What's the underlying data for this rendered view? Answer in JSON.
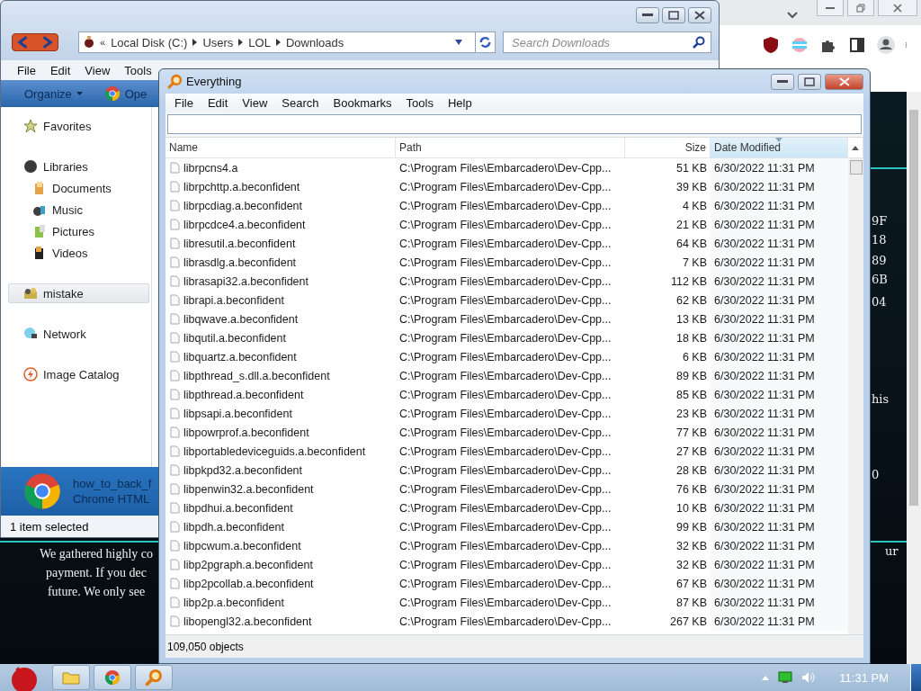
{
  "browser": {
    "page_lines": [
      "We gathered highly co",
      "payment. If you dec",
      "future. We only see"
    ],
    "page_fragments": [
      {
        "text": "ur",
        "kind": "right"
      },
      {
        "text": "9F",
        "kind": "edge"
      },
      {
        "text": "18",
        "kind": "edge"
      },
      {
        "text": "89",
        "kind": "edge"
      },
      {
        "text": "6B",
        "kind": "edge"
      },
      {
        "text": "04",
        "kind": "edge"
      },
      {
        "text": "his",
        "kind": "edge"
      },
      {
        "text": "0",
        "kind": "edge"
      }
    ]
  },
  "explorer": {
    "overflow": "«",
    "crumbs": [
      "Local Disk (C:)",
      "Users",
      "LOL",
      "Downloads"
    ],
    "search": {
      "placeholder": "Search Downloads"
    },
    "menu": [
      "File",
      "Edit",
      "View",
      "Tools"
    ],
    "commands": [
      "Organize",
      "Ope"
    ],
    "sidebar": [
      {
        "label": "Favorites",
        "kind": "star",
        "selected": false
      },
      {
        "label": "Libraries",
        "kind": "library",
        "selected": false,
        "children": [
          {
            "label": "Documents",
            "kind": "docs"
          },
          {
            "label": "Music",
            "kind": "music"
          },
          {
            "label": "Pictures",
            "kind": "pictures"
          },
          {
            "label": "Videos",
            "kind": "videos"
          }
        ]
      },
      {
        "label": "mistake",
        "kind": "homegroup",
        "selected": true
      },
      {
        "label": "Network",
        "kind": "network",
        "selected": false
      },
      {
        "label": "Image Catalog",
        "kind": "catalog",
        "selected": false
      }
    ],
    "details": {
      "name": "how_to_back_f",
      "type": "Chrome HTML"
    },
    "status": "1 item selected"
  },
  "everything": {
    "title": "Everything",
    "menu": [
      "File",
      "Edit",
      "View",
      "Search",
      "Bookmarks",
      "Tools",
      "Help"
    ],
    "columns": [
      {
        "label": "Name",
        "sorted": false
      },
      {
        "label": "Path",
        "sorted": false
      },
      {
        "label": "Size",
        "sorted": false
      },
      {
        "label": "Date Modified",
        "sorted": true
      }
    ],
    "rows": [
      {
        "name": "librpcns4.a",
        "path": "C:\\Program Files\\Embarcadero\\Dev-Cpp...",
        "size": "51 KB",
        "date": "6/30/2022 11:31 PM"
      },
      {
        "name": "librpchttp.a.beconfident",
        "path": "C:\\Program Files\\Embarcadero\\Dev-Cpp...",
        "size": "39 KB",
        "date": "6/30/2022 11:31 PM"
      },
      {
        "name": "librpcdiag.a.beconfident",
        "path": "C:\\Program Files\\Embarcadero\\Dev-Cpp...",
        "size": "4 KB",
        "date": "6/30/2022 11:31 PM"
      },
      {
        "name": "librpcdce4.a.beconfident",
        "path": "C:\\Program Files\\Embarcadero\\Dev-Cpp...",
        "size": "21 KB",
        "date": "6/30/2022 11:31 PM"
      },
      {
        "name": "libresutil.a.beconfident",
        "path": "C:\\Program Files\\Embarcadero\\Dev-Cpp...",
        "size": "64 KB",
        "date": "6/30/2022 11:31 PM"
      },
      {
        "name": "librasdlg.a.beconfident",
        "path": "C:\\Program Files\\Embarcadero\\Dev-Cpp...",
        "size": "7 KB",
        "date": "6/30/2022 11:31 PM"
      },
      {
        "name": "librasapi32.a.beconfident",
        "path": "C:\\Program Files\\Embarcadero\\Dev-Cpp...",
        "size": "112 KB",
        "date": "6/30/2022 11:31 PM"
      },
      {
        "name": "librapi.a.beconfident",
        "path": "C:\\Program Files\\Embarcadero\\Dev-Cpp...",
        "size": "62 KB",
        "date": "6/30/2022 11:31 PM"
      },
      {
        "name": "libqwave.a.beconfident",
        "path": "C:\\Program Files\\Embarcadero\\Dev-Cpp...",
        "size": "13 KB",
        "date": "6/30/2022 11:31 PM"
      },
      {
        "name": "libqutil.a.beconfident",
        "path": "C:\\Program Files\\Embarcadero\\Dev-Cpp...",
        "size": "18 KB",
        "date": "6/30/2022 11:31 PM"
      },
      {
        "name": "libquartz.a.beconfident",
        "path": "C:\\Program Files\\Embarcadero\\Dev-Cpp...",
        "size": "6 KB",
        "date": "6/30/2022 11:31 PM"
      },
      {
        "name": "libpthread_s.dll.a.beconfident",
        "path": "C:\\Program Files\\Embarcadero\\Dev-Cpp...",
        "size": "89 KB",
        "date": "6/30/2022 11:31 PM"
      },
      {
        "name": "libpthread.a.beconfident",
        "path": "C:\\Program Files\\Embarcadero\\Dev-Cpp...",
        "size": "85 KB",
        "date": "6/30/2022 11:31 PM"
      },
      {
        "name": "libpsapi.a.beconfident",
        "path": "C:\\Program Files\\Embarcadero\\Dev-Cpp...",
        "size": "23 KB",
        "date": "6/30/2022 11:31 PM"
      },
      {
        "name": "libpowrprof.a.beconfident",
        "path": "C:\\Program Files\\Embarcadero\\Dev-Cpp...",
        "size": "77 KB",
        "date": "6/30/2022 11:31 PM"
      },
      {
        "name": "libportabledeviceguids.a.beconfident",
        "path": "C:\\Program Files\\Embarcadero\\Dev-Cpp...",
        "size": "27 KB",
        "date": "6/30/2022 11:31 PM"
      },
      {
        "name": "libpkpd32.a.beconfident",
        "path": "C:\\Program Files\\Embarcadero\\Dev-Cpp...",
        "size": "28 KB",
        "date": "6/30/2022 11:31 PM"
      },
      {
        "name": "libpenwin32.a.beconfident",
        "path": "C:\\Program Files\\Embarcadero\\Dev-Cpp...",
        "size": "76 KB",
        "date": "6/30/2022 11:31 PM"
      },
      {
        "name": "libpdhui.a.beconfident",
        "path": "C:\\Program Files\\Embarcadero\\Dev-Cpp...",
        "size": "10 KB",
        "date": "6/30/2022 11:31 PM"
      },
      {
        "name": "libpdh.a.beconfident",
        "path": "C:\\Program Files\\Embarcadero\\Dev-Cpp...",
        "size": "99 KB",
        "date": "6/30/2022 11:31 PM"
      },
      {
        "name": "libpcwum.a.beconfident",
        "path": "C:\\Program Files\\Embarcadero\\Dev-Cpp...",
        "size": "32 KB",
        "date": "6/30/2022 11:31 PM"
      },
      {
        "name": "libp2pgraph.a.beconfident",
        "path": "C:\\Program Files\\Embarcadero\\Dev-Cpp...",
        "size": "32 KB",
        "date": "6/30/2022 11:31 PM"
      },
      {
        "name": "libp2pcollab.a.beconfident",
        "path": "C:\\Program Files\\Embarcadero\\Dev-Cpp...",
        "size": "67 KB",
        "date": "6/30/2022 11:31 PM"
      },
      {
        "name": "libp2p.a.beconfident",
        "path": "C:\\Program Files\\Embarcadero\\Dev-Cpp...",
        "size": "87 KB",
        "date": "6/30/2022 11:31 PM"
      },
      {
        "name": "libopengl32.a.beconfident",
        "path": "C:\\Program Files\\Embarcadero\\Dev-Cpp...",
        "size": "267 KB",
        "date": "6/30/2022 11:31 PM"
      }
    ],
    "status": "109,050 objects"
  },
  "taskbar": {
    "apps": [
      {
        "kind": "folder"
      },
      {
        "kind": "chrome"
      },
      {
        "kind": "everything"
      }
    ],
    "clock": "11:31 PM"
  }
}
